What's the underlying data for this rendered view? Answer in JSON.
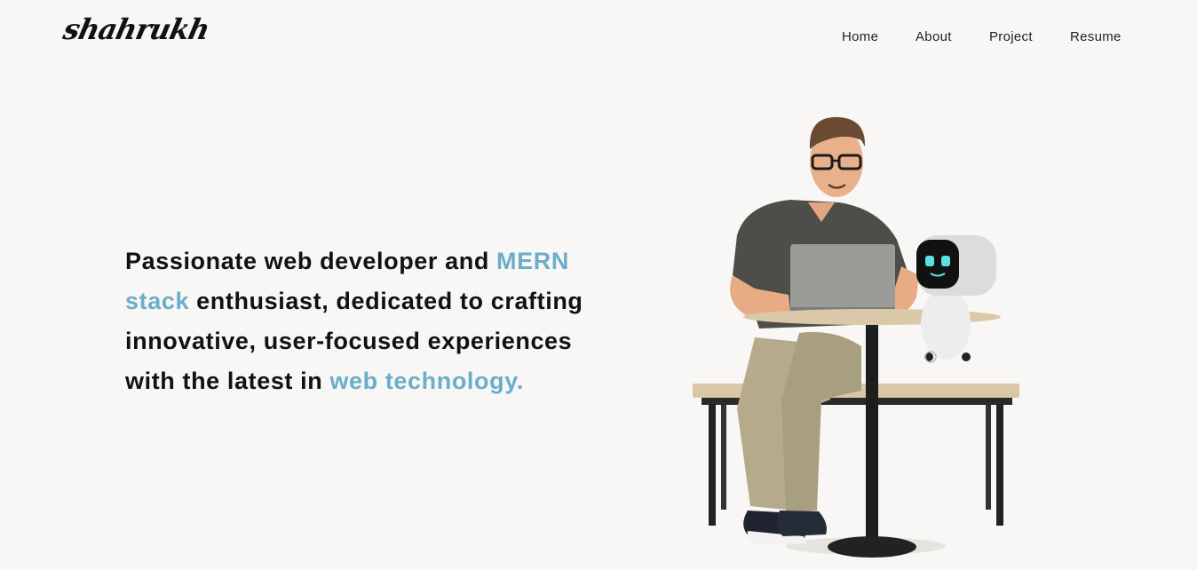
{
  "header": {
    "logo": "shahrukh",
    "nav": [
      {
        "label": "Home"
      },
      {
        "label": "About"
      },
      {
        "label": "Project"
      },
      {
        "label": "Resume"
      }
    ]
  },
  "hero": {
    "line_a": "Passionate web developer and ",
    "accent_a": "MERN stack",
    "line_b": " enthusiast, dedicated to crafting innovative, user-focused experiences with the latest in ",
    "accent_b": "web technology."
  },
  "colors": {
    "background": "#f8f7f5",
    "accent": "#6aaec9",
    "text": "#111111"
  }
}
